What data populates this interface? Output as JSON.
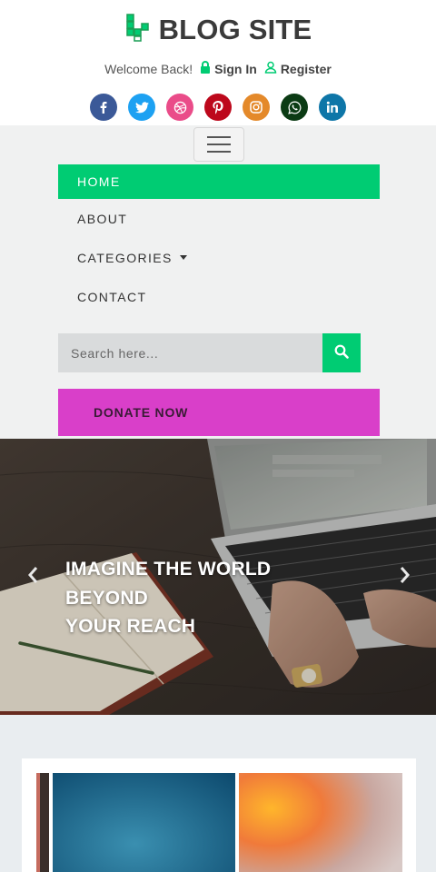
{
  "header": {
    "logo_text": "BLOG SITE",
    "welcome_text": "Welcome Back!",
    "signin_label": "Sign In",
    "register_label": "Register",
    "accent_color": "#00cc73"
  },
  "socials": [
    {
      "name": "facebook",
      "glyph": "f",
      "color": "#3b5998"
    },
    {
      "name": "twitter",
      "glyph": "t",
      "color": "#1da1f2"
    },
    {
      "name": "dribbble",
      "glyph": "d",
      "color": "#ea4c89"
    },
    {
      "name": "pinterest",
      "glyph": "p",
      "color": "#bd081c"
    },
    {
      "name": "instagram",
      "glyph": "i",
      "color": "#e4892a"
    },
    {
      "name": "whatsapp",
      "glyph": "w",
      "color": "#0b3b14"
    },
    {
      "name": "linkedin",
      "glyph": "in",
      "color": "#0e76a8"
    }
  ],
  "nav": {
    "items": [
      {
        "label": "HOME",
        "active": true
      },
      {
        "label": "ABOUT",
        "active": false
      },
      {
        "label": "CATEGORIES",
        "active": false,
        "dropdown": true
      },
      {
        "label": "CONTACT",
        "active": false
      }
    ],
    "search_placeholder": "Search here...",
    "donate_label": "DONATE NOW",
    "donate_color": "#d93fc9"
  },
  "hero": {
    "title": "IMAGINE THE WORLD\nBEYOND\nYOUR REACH"
  }
}
